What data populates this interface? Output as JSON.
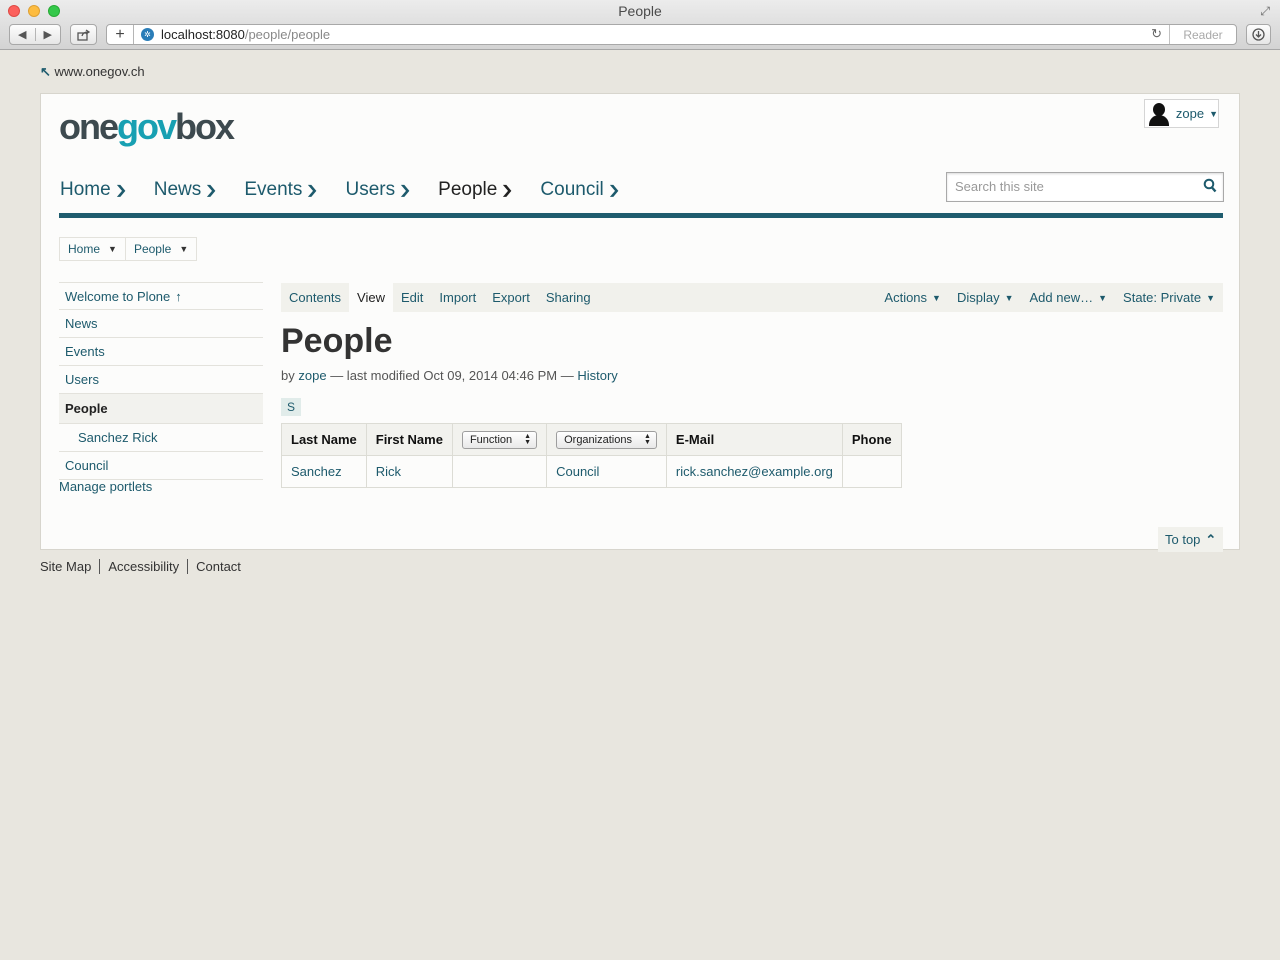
{
  "browser": {
    "window_title": "People",
    "url_host": "localhost:8080",
    "url_path": "/people/people",
    "reader_label": "Reader"
  },
  "site": {
    "back_link": "www.onegov.ch",
    "logo": {
      "one": "one",
      "gov": "gov",
      "box": "box"
    },
    "user_label": "zope",
    "search_placeholder": "Search this site"
  },
  "main_nav": [
    {
      "label": "Home"
    },
    {
      "label": "News"
    },
    {
      "label": "Events"
    },
    {
      "label": "Users"
    },
    {
      "label": "People",
      "active": true
    },
    {
      "label": "Council"
    }
  ],
  "breadcrumb": [
    {
      "label": "Home"
    },
    {
      "label": "People"
    }
  ],
  "portlet": {
    "items": [
      {
        "label": "Welcome to Plone",
        "icon": "arrow-up-icon"
      },
      {
        "label": "News"
      },
      {
        "label": "Events"
      },
      {
        "label": "Users"
      },
      {
        "label": "People",
        "active": true
      },
      {
        "label": "Sanchez Rick",
        "sub": true
      },
      {
        "label": "Council"
      }
    ],
    "manage_label": "Manage portlets"
  },
  "editbar": {
    "tabs": [
      "Contents",
      "View",
      "Edit",
      "Import",
      "Export",
      "Sharing"
    ],
    "active_tab": "View",
    "menus": [
      "Actions",
      "Display",
      "Add new…",
      "State: Private"
    ]
  },
  "content": {
    "title": "People",
    "byline": {
      "by": "by",
      "author": "zope",
      "modified": "— last modified Oct 09, 2014 04:46 PM —",
      "history": "History"
    },
    "letter_filter": "S",
    "table": {
      "headers": {
        "last_name": "Last Name",
        "first_name": "First Name",
        "function": "Function",
        "organizations": "Organizations",
        "email": "E-Mail",
        "phone": "Phone"
      },
      "rows": [
        {
          "last_name": "Sanchez",
          "first_name": "Rick",
          "function": "",
          "organizations": "Council",
          "email": "rick.sanchez@example.org",
          "phone": ""
        }
      ]
    },
    "to_top": "To top"
  },
  "footer": [
    "Site Map",
    "Accessibility",
    "Contact"
  ]
}
